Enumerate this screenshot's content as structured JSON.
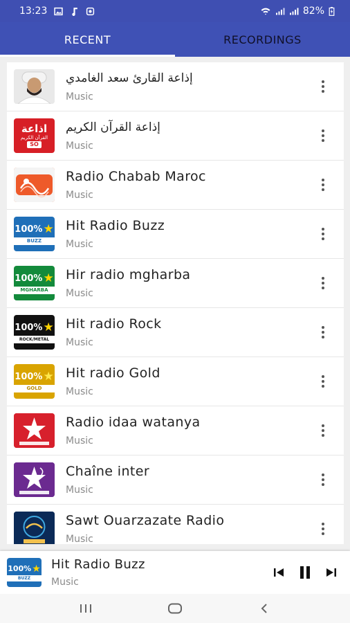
{
  "status_bar": {
    "time": "13:23",
    "battery": "82%"
  },
  "tabs": [
    {
      "label": "RECENT",
      "active": true
    },
    {
      "label": "RECORDINGS",
      "active": false
    }
  ],
  "stations": [
    {
      "title": "إذاعة القارئ سعد الغامدي",
      "subtitle": "Music",
      "logo": "portrait-logo",
      "logo_text": ""
    },
    {
      "title": "إذاعة القرآن الكريم",
      "subtitle": "Music",
      "logo": "quran-radio-logo",
      "logo_text": "اذاعة",
      "logo_small": "القرآن الكريم",
      "logo_num": "SO"
    },
    {
      "title": "Radio Chabab Maroc",
      "subtitle": "Music",
      "logo": "chabab-logo",
      "logo_text": ""
    },
    {
      "title": "Hit Radio Buzz",
      "subtitle": "Music",
      "logo": "hit-radio-logo",
      "logo_text": "100%",
      "logo_band": "BUZZ",
      "logo_color": "#1f6fb8",
      "band_color": "#1f6fb8"
    },
    {
      "title": "Hir radio mgharba",
      "subtitle": "Music",
      "logo": "hit-radio-logo",
      "logo_text": "100%",
      "logo_band": "MGHARBA",
      "logo_color": "#138a3b",
      "band_color": "#138a3b"
    },
    {
      "title": "Hit radio Rock",
      "subtitle": "Music",
      "logo": "hit-radio-logo",
      "logo_text": "100%",
      "logo_band": "ROCK/METAL",
      "logo_color": "#111111",
      "band_color": "#111111"
    },
    {
      "title": "Hit radio Gold",
      "subtitle": "Music",
      "logo": "hit-radio-logo",
      "logo_text": "100%",
      "logo_band": "GOLD",
      "logo_color": "#d9a400",
      "band_color": "#d9a400"
    },
    {
      "title": "Radio idaa watanya",
      "subtitle": "Music",
      "logo": "watanya-logo",
      "logo_text": ""
    },
    {
      "title": "Chaîne inter",
      "subtitle": "Music",
      "logo": "chaine-inter-logo",
      "logo_text": ""
    },
    {
      "title": "Sawt Ouarzazate Radio",
      "subtitle": "Music",
      "logo": "ouarzazate-logo",
      "logo_text": ""
    }
  ],
  "player": {
    "title": "Hit Radio Buzz",
    "subtitle": "Music",
    "logo_text": "100%",
    "logo_band": "BUZZ"
  },
  "colors": {
    "primary": "#3f51b5",
    "status_bar": "#3f4fb2",
    "background": "#efefef"
  }
}
